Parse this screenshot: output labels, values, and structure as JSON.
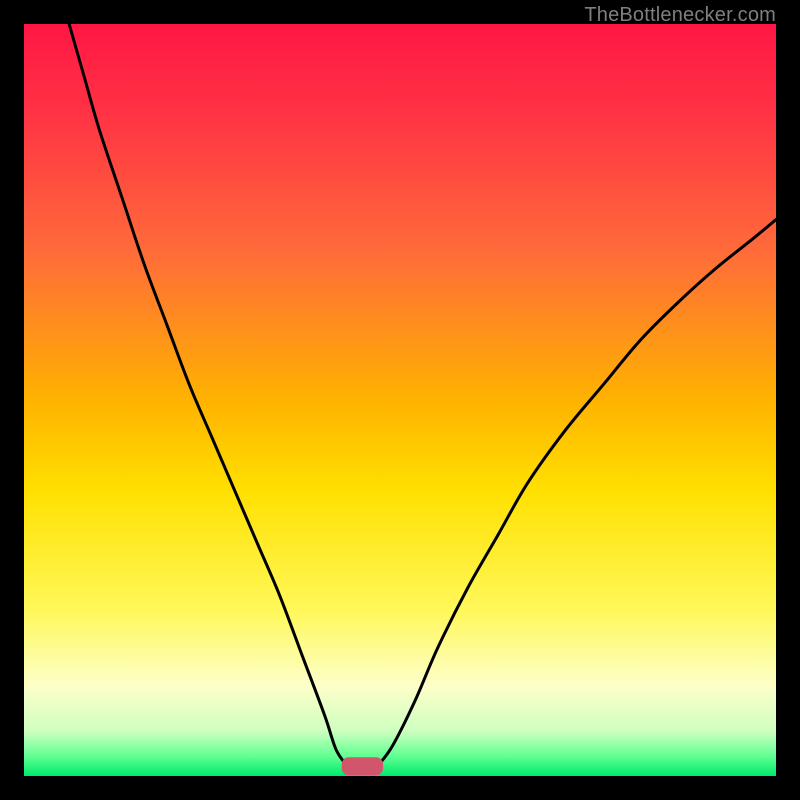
{
  "watermark": "TheBottlenecker.com",
  "chart_data": {
    "type": "line",
    "title": "",
    "xlabel": "",
    "ylabel": "",
    "xlim": [
      0,
      100
    ],
    "ylim": [
      0,
      100
    ],
    "gradient_stops": [
      {
        "offset": 0.0,
        "color": "#ff1744"
      },
      {
        "offset": 0.12,
        "color": "#ff3344"
      },
      {
        "offset": 0.3,
        "color": "#ff6a3a"
      },
      {
        "offset": 0.5,
        "color": "#ffb200"
      },
      {
        "offset": 0.62,
        "color": "#ffe000"
      },
      {
        "offset": 0.78,
        "color": "#fff85a"
      },
      {
        "offset": 0.88,
        "color": "#fdffc9"
      },
      {
        "offset": 0.94,
        "color": "#cfffc0"
      },
      {
        "offset": 0.975,
        "color": "#5cff90"
      },
      {
        "offset": 1.0,
        "color": "#00e86b"
      }
    ],
    "series": [
      {
        "name": "left-curve",
        "x": [
          6,
          8,
          10,
          13,
          16,
          19,
          22,
          25,
          28,
          31,
          34,
          37,
          40,
          41.5,
          43
        ],
        "values": [
          100,
          93,
          86,
          77,
          68,
          60,
          52,
          45,
          38,
          31,
          24,
          16,
          8,
          3.5,
          1.3
        ]
      },
      {
        "name": "right-curve",
        "x": [
          47,
          49,
          52,
          55,
          59,
          63,
          67,
          72,
          77,
          82,
          87,
          92,
          97,
          100
        ],
        "values": [
          1.3,
          4,
          10,
          17,
          25,
          32,
          39,
          46,
          52,
          58,
          63,
          67.5,
          71.5,
          74
        ]
      }
    ],
    "marker": {
      "name": "bottleneck-indicator",
      "x_center": 45,
      "width": 5.5,
      "y": 1.3,
      "height": 2.4,
      "fill": "#d1566b"
    }
  }
}
